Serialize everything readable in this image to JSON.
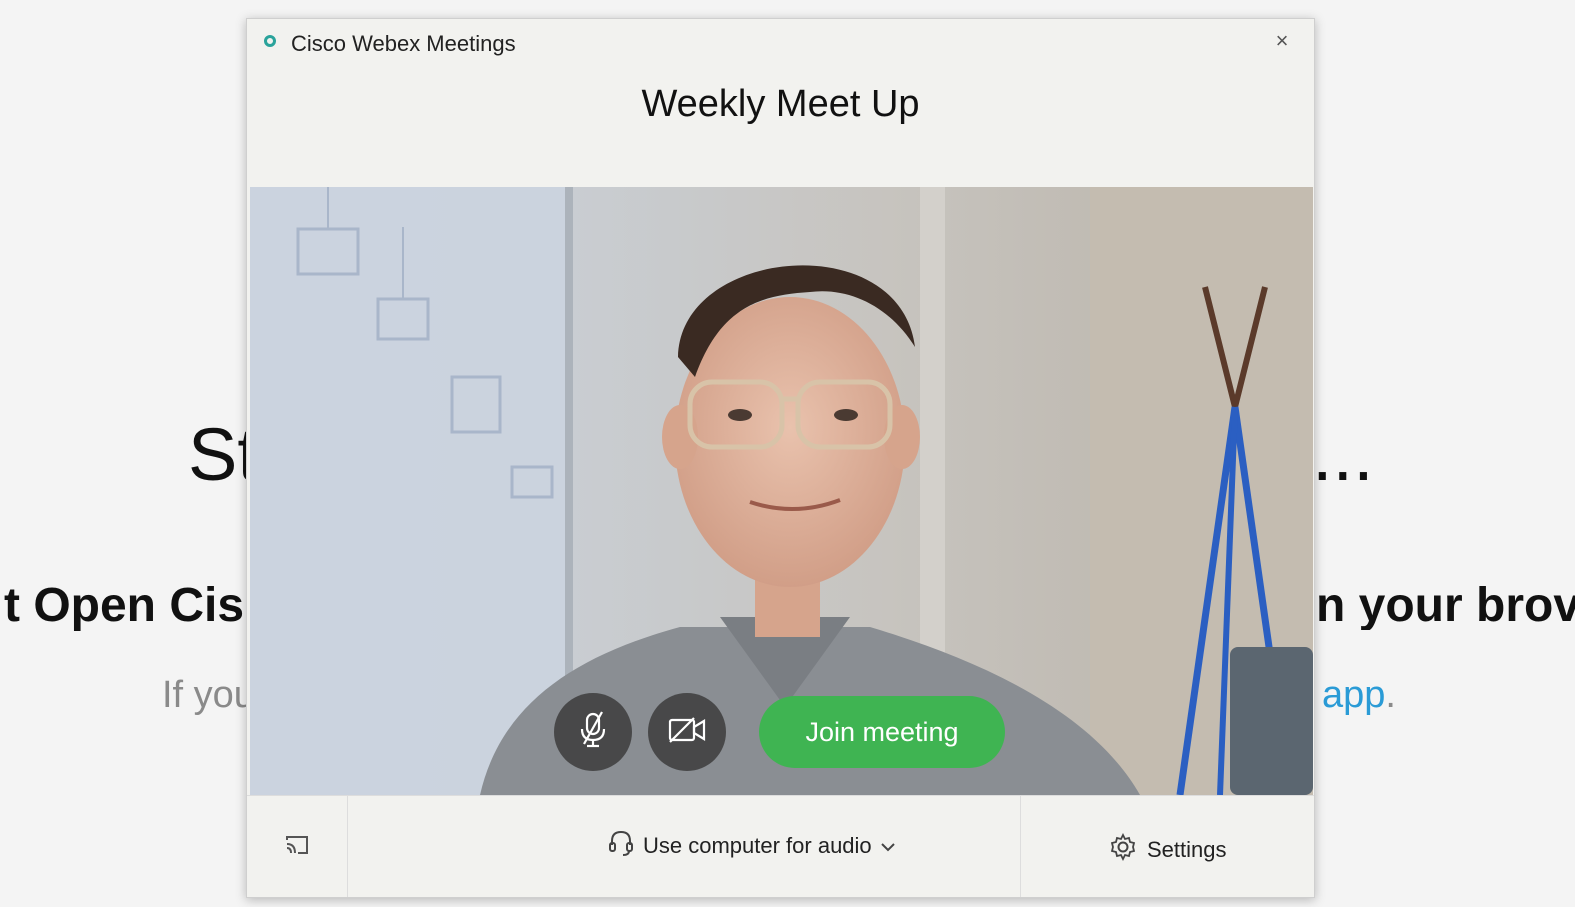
{
  "background_page": {
    "heading_left": "St",
    "heading_right": "...",
    "line2_left": "t Open Cis",
    "line2_right": "n your brov",
    "line3_left": "If you",
    "line3_link": "app",
    "line3_period": "."
  },
  "dialog": {
    "app_name": "Cisco Webex Meetings",
    "close_label": "×",
    "meeting_title": "Weekly Meet Up",
    "join_label": "Join meeting",
    "audio_label": "Use computer for audio",
    "settings_label": "Settings",
    "icons": {
      "mute": "mic-muted-icon",
      "video": "video-off-icon",
      "cast": "cast-icon",
      "headset": "headset-icon",
      "chevron": "chevron-down-icon",
      "gear": "gear-icon"
    },
    "colors": {
      "join": "#3fb452",
      "app_icon": "#2aa39b",
      "link": "#2a9bd6"
    }
  }
}
